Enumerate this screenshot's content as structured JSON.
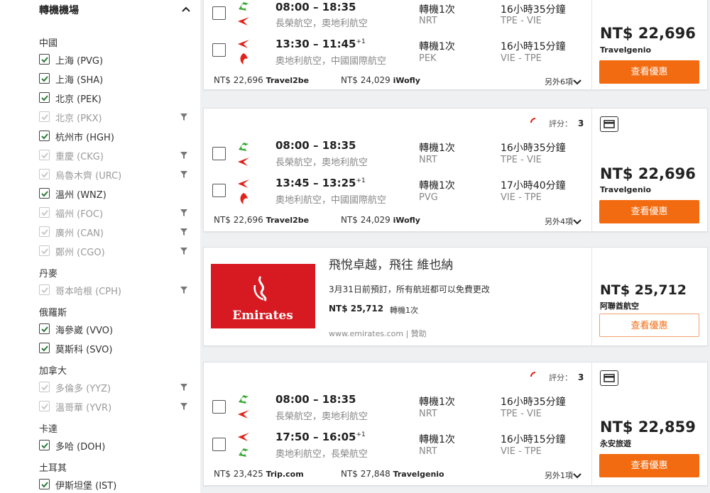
{
  "sidebar": {
    "title": "轉機機場",
    "groups": [
      {
        "name": "中國",
        "items": [
          {
            "label": "上海 (PVG)",
            "checked": true,
            "disabled": false,
            "filter": false
          },
          {
            "label": "上海 (SHA)",
            "checked": true,
            "disabled": false,
            "filter": false
          },
          {
            "label": "北京 (PEK)",
            "checked": true,
            "disabled": false,
            "filter": false
          },
          {
            "label": "北京 (PKX)",
            "checked": true,
            "disabled": true,
            "filter": true
          },
          {
            "label": "杭州市 (HGH)",
            "checked": true,
            "disabled": false,
            "filter": false
          },
          {
            "label": "重慶 (CKG)",
            "checked": true,
            "disabled": true,
            "filter": true
          },
          {
            "label": "烏魯木齊 (URC)",
            "checked": true,
            "disabled": true,
            "filter": true
          },
          {
            "label": "溫州 (WNZ)",
            "checked": true,
            "disabled": false,
            "filter": false
          },
          {
            "label": "福州 (FOC)",
            "checked": true,
            "disabled": true,
            "filter": true
          },
          {
            "label": "廣州 (CAN)",
            "checked": true,
            "disabled": true,
            "filter": true
          },
          {
            "label": "鄭州 (CGO)",
            "checked": true,
            "disabled": true,
            "filter": true
          }
        ]
      },
      {
        "name": "丹麥",
        "items": [
          {
            "label": "哥本哈根 (CPH)",
            "checked": true,
            "disabled": true,
            "filter": true
          }
        ]
      },
      {
        "name": "俄羅斯",
        "items": [
          {
            "label": "海參崴 (VVO)",
            "checked": true,
            "disabled": false,
            "filter": false
          },
          {
            "label": "莫斯科 (SVO)",
            "checked": true,
            "disabled": false,
            "filter": false
          }
        ]
      },
      {
        "name": "加拿大",
        "items": [
          {
            "label": "多倫多 (YYZ)",
            "checked": true,
            "disabled": true,
            "filter": true
          },
          {
            "label": "溫哥華 (YVR)",
            "checked": true,
            "disabled": true,
            "filter": true
          }
        ]
      },
      {
        "name": "卡達",
        "items": [
          {
            "label": "多哈 (DOH)",
            "checked": true,
            "disabled": false,
            "filter": false
          }
        ]
      },
      {
        "name": "土耳其",
        "items": [
          {
            "label": "伊斯坦堡 (IST)",
            "checked": true,
            "disabled": false,
            "filter": false
          }
        ]
      }
    ]
  },
  "colors": {
    "accent": "#f26b10",
    "emirates_red": "#d71a21",
    "eva_green": "#3aa935",
    "austrian_red": "#e2231a"
  },
  "cards": [
    {
      "legs": [
        {
          "times": "08:00 – 18:35",
          "plus": "",
          "carrier": "長榮航空，奧地利航空",
          "logo": "eva-air-logo",
          "stops": "轉機1次",
          "airport": "NRT",
          "duration": "16小時35分鐘",
          "route": "TPE - VIE"
        },
        {
          "times": "13:30 – 11:45",
          "plus": "+1",
          "carrier": "奧地利航空，中國國際航空",
          "logo": "air-china-logo",
          "stops": "轉機1次",
          "airport": "PEK",
          "duration": "16小時15分鐘",
          "route": "VIE - TPE"
        }
      ],
      "alt_prices": [
        {
          "price": "NT$ 22,696",
          "vendor": "Travel2be"
        },
        {
          "price": "NT$ 24,029",
          "vendor": "iWofly"
        }
      ],
      "more": "另外6項",
      "price": "NT$ 22,696",
      "vendor": "Travelgenio",
      "button": "查看優惠"
    },
    {
      "rating_label": "評分：",
      "rating_value": "3",
      "legs": [
        {
          "times": "08:00 – 18:35",
          "plus": "",
          "carrier": "長榮航空，奧地利航空",
          "logo": "eva-air-logo",
          "stops": "轉機1次",
          "airport": "NRT",
          "duration": "16小時35分鐘",
          "route": "TPE - VIE"
        },
        {
          "times": "13:45 – 13:25",
          "plus": "+1",
          "carrier": "奧地利航空，中國國際航空",
          "logo": "air-china-logo",
          "stops": "轉機1次",
          "airport": "PVG",
          "duration": "17小時40分鐘",
          "route": "VIE - TPE"
        }
      ],
      "alt_prices": [
        {
          "price": "NT$ 22,696",
          "vendor": "Travel2be"
        },
        {
          "price": "NT$ 24,029",
          "vendor": "iWofly"
        }
      ],
      "more": "另外4項",
      "price": "NT$ 22,696",
      "vendor": "Travelgenio",
      "button": "查看優惠"
    },
    {
      "rating_label": "評分：",
      "rating_value": "3",
      "legs": [
        {
          "times": "08:00 – 18:35",
          "plus": "",
          "carrier": "長榮航空，奧地利航空",
          "logo": "eva-air-logo",
          "stops": "轉機1次",
          "airport": "NRT",
          "duration": "16小時35分鐘",
          "route": "TPE - VIE"
        },
        {
          "times": "17:50 – 16:05",
          "plus": "+1",
          "carrier": "奧地利航空，長榮航空",
          "logo": "eva-air-logo",
          "stops": "轉機1次",
          "airport": "NRT",
          "duration": "16小時15分鐘",
          "route": "VIE - TPE"
        }
      ],
      "alt_prices": [
        {
          "price": "NT$ 23,425",
          "vendor": "Trip.com"
        },
        {
          "price": "NT$ 27,848",
          "vendor": "Travelgenio"
        }
      ],
      "more": "另外1項",
      "price": "NT$ 22,859",
      "vendor": "永安旅遊",
      "button": "查看優惠"
    }
  ],
  "ad": {
    "logo_text": "Emirates",
    "title": "飛悅卓越，飛往 維也納",
    "desc": "3月31日前預訂，所有航班都可以免費更改",
    "price": "NT$ 25,712",
    "stops": "轉機1次",
    "url": "www.emirates.com | 贊助",
    "side_price": "NT$ 25,712",
    "side_vendor": "阿聯酋航空",
    "button": "查看優惠"
  }
}
